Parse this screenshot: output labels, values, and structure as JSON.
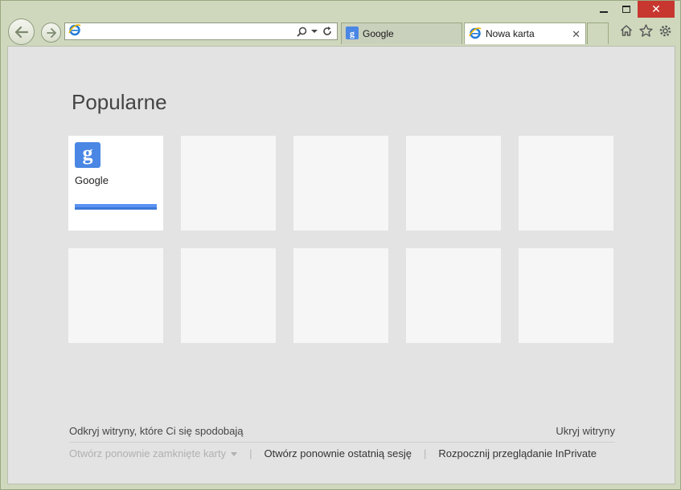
{
  "window": {
    "caption": {
      "minimize": "minimize",
      "maximize": "maximize",
      "close": "close"
    }
  },
  "address_bar": {
    "value": "",
    "placeholder": ""
  },
  "tabs": [
    {
      "label": "Google",
      "icon": "google-favicon",
      "active": false
    },
    {
      "label": "Nowa karta",
      "icon": "ie-icon",
      "active": true,
      "close_glyph": "✕"
    }
  ],
  "toolbar_icons": [
    "home-icon",
    "star-icon",
    "gear-icon"
  ],
  "content": {
    "heading": "Popularne",
    "tiles": [
      {
        "name": "Google",
        "logo_letter": "g",
        "accent": "#4a87e5"
      },
      {
        "name": ""
      },
      {
        "name": ""
      },
      {
        "name": ""
      },
      {
        "name": ""
      },
      {
        "name": ""
      },
      {
        "name": ""
      },
      {
        "name": ""
      },
      {
        "name": ""
      },
      {
        "name": ""
      }
    ],
    "footer": {
      "discover": "Odkryj witryny, które Ci się spodobają",
      "hide_sites": "Ukryj witryny",
      "reopen_closed_tabs": "Otwórz ponownie zamknięte karty",
      "reopen_last_session": "Otwórz ponownie ostatnią sesję",
      "start_inprivate": "Rozpocznij przeglądanie InPrivate",
      "separator": "|"
    }
  },
  "colors": {
    "frame": "#cfd8bd",
    "close_button": "#c7372f",
    "page_background": "#e3e3e3",
    "tile_background": "#f6f6f6",
    "google_blue": "#4a87e5"
  }
}
